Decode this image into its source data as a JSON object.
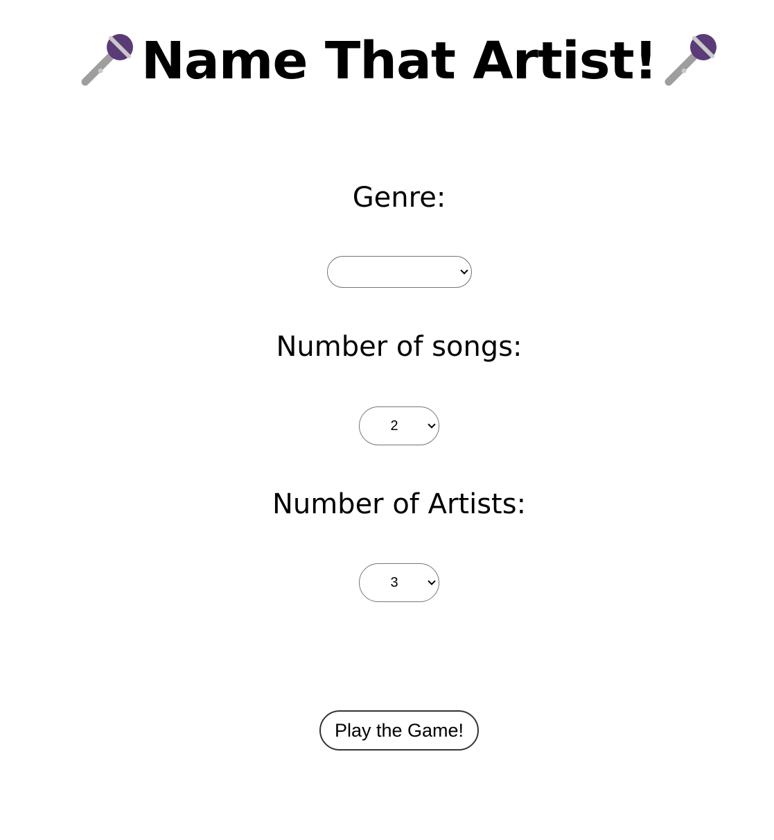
{
  "header": {
    "title": "Name That Artist!",
    "left_icon": "microphone-icon",
    "right_icon": "microphone-icon"
  },
  "form": {
    "genre": {
      "label": "Genre:",
      "selected": ""
    },
    "songs": {
      "label": "Number of songs:",
      "selected": "2"
    },
    "artists": {
      "label": "Number of Artists:",
      "selected": "3"
    }
  },
  "actions": {
    "play_label": "Play the Game!"
  },
  "colors": {
    "mic_head": "#5b3a78",
    "mic_body": "#9e9e9e",
    "mic_band": "#c9c9c9"
  }
}
